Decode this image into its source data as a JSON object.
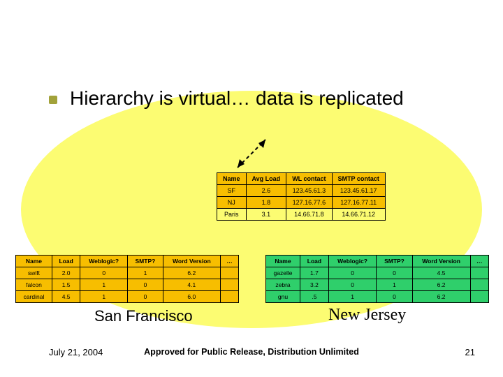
{
  "title": "Hierarchy is virtual… data is replicated",
  "top_table": {
    "headers": [
      "Name",
      "Avg Load",
      "WL contact",
      "SMTP contact"
    ],
    "rows": [
      [
        "SF",
        "2.6",
        "123.45.61.3",
        "123.45.61.17"
      ],
      [
        "NJ",
        "1.8",
        "127.16.77.6",
        "127.16.77.11"
      ],
      [
        "Paris",
        "3.1",
        "14.66.71.8",
        "14.66.71.12"
      ]
    ]
  },
  "left_table": {
    "headers": [
      "Name",
      "Load",
      "Weblogic?",
      "SMTP?",
      "Word Version",
      "…"
    ],
    "rows": [
      [
        "swift",
        "2.0",
        "0",
        "1",
        "6.2",
        ""
      ],
      [
        "falcon",
        "1.5",
        "1",
        "0",
        "4.1",
        ""
      ],
      [
        "cardinal",
        "4.5",
        "1",
        "0",
        "6.0",
        ""
      ]
    ]
  },
  "right_table": {
    "headers": [
      "Name",
      "Load",
      "Weblogic?",
      "SMTP?",
      "Word Version",
      "…"
    ],
    "rows": [
      [
        "gazelle",
        "1.7",
        "0",
        "0",
        "4.5",
        ""
      ],
      [
        "zebra",
        "3.2",
        "0",
        "1",
        "6.2",
        ""
      ],
      [
        "gnu",
        ".5",
        "1",
        "0",
        "6.2",
        ""
      ]
    ]
  },
  "caption_left": "San Francisco",
  "caption_right": "New Jersey",
  "footer": {
    "date": "July 21, 2004",
    "center": "Approved for Public Release, Distribution Unlimited",
    "page": "21"
  }
}
